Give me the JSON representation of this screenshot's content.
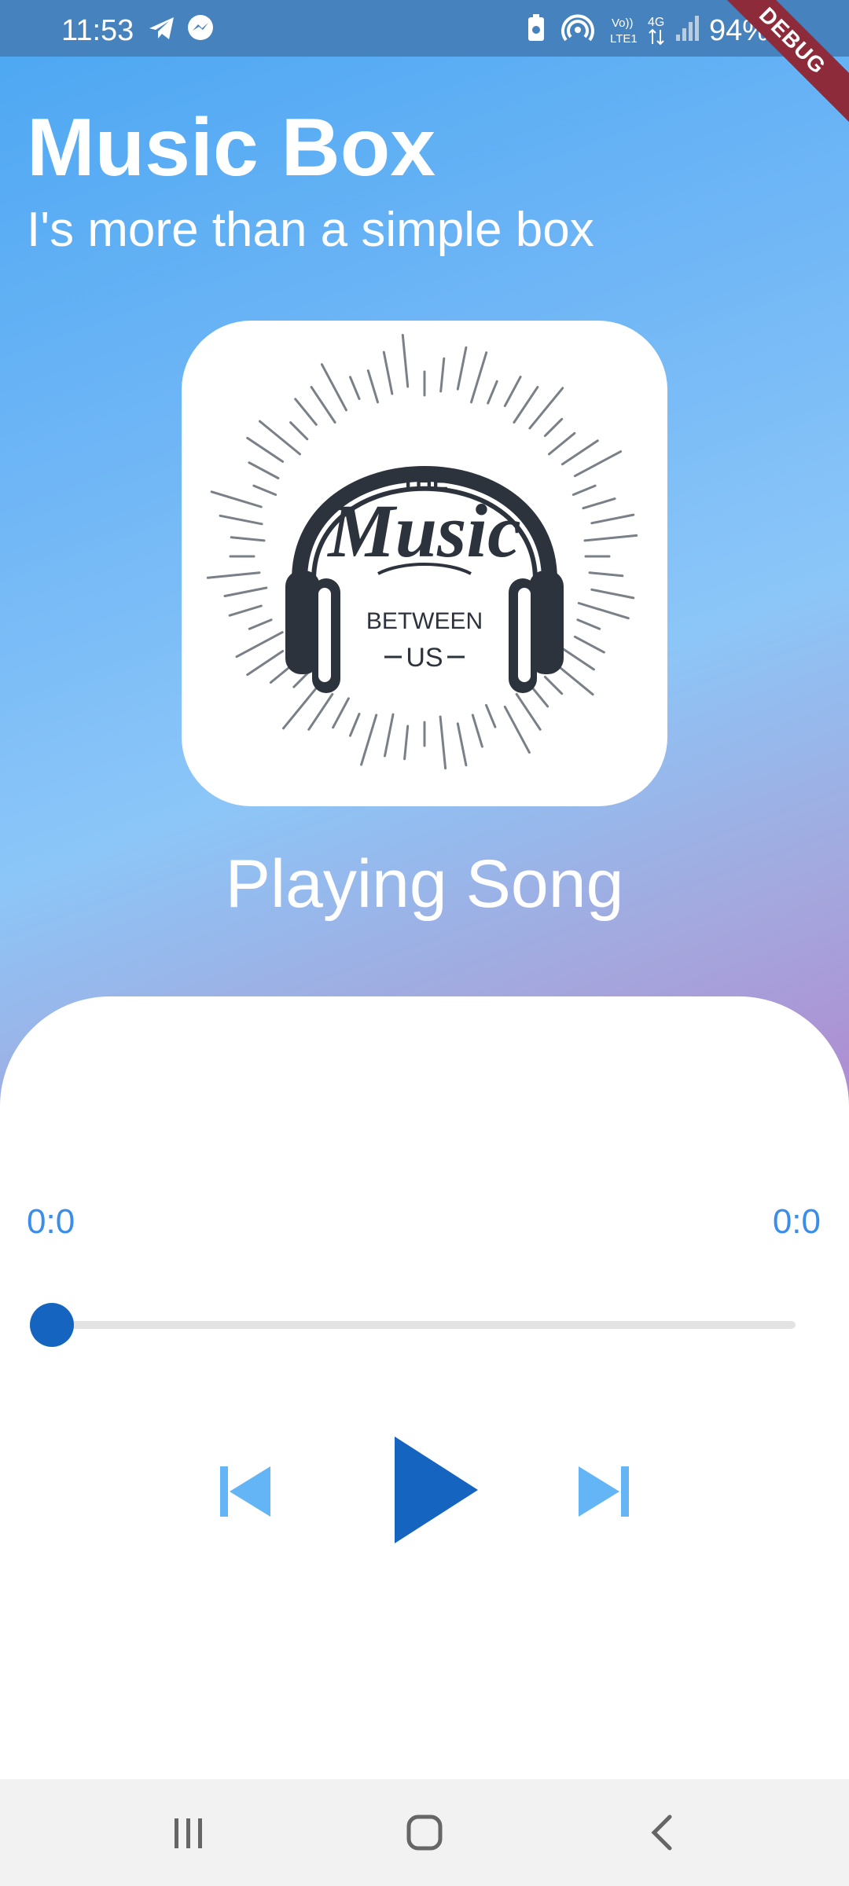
{
  "status_bar": {
    "time": "11:53",
    "battery_percent": "94%"
  },
  "debug_banner": "DEBUG",
  "header": {
    "title": "Music Box",
    "subtitle": "I's more than a simple box"
  },
  "album_art": {
    "line_top": "THE",
    "line_main": "Music",
    "line_mid": "BETWEEN",
    "line_bottom": "US"
  },
  "now_playing": {
    "title": "Playing Song",
    "elapsed": "0:0",
    "duration": "0:0",
    "progress": 0
  },
  "colors": {
    "accent": "#1565c0",
    "accent_light": "#64b5f6",
    "time_text": "#3a8de8"
  },
  "controls": {
    "previous_icon": "skip-previous-icon",
    "play_icon": "play-icon",
    "next_icon": "skip-next-icon"
  },
  "nav": {
    "recents_icon": "recents-icon",
    "home_icon": "home-icon",
    "back_icon": "back-icon"
  }
}
